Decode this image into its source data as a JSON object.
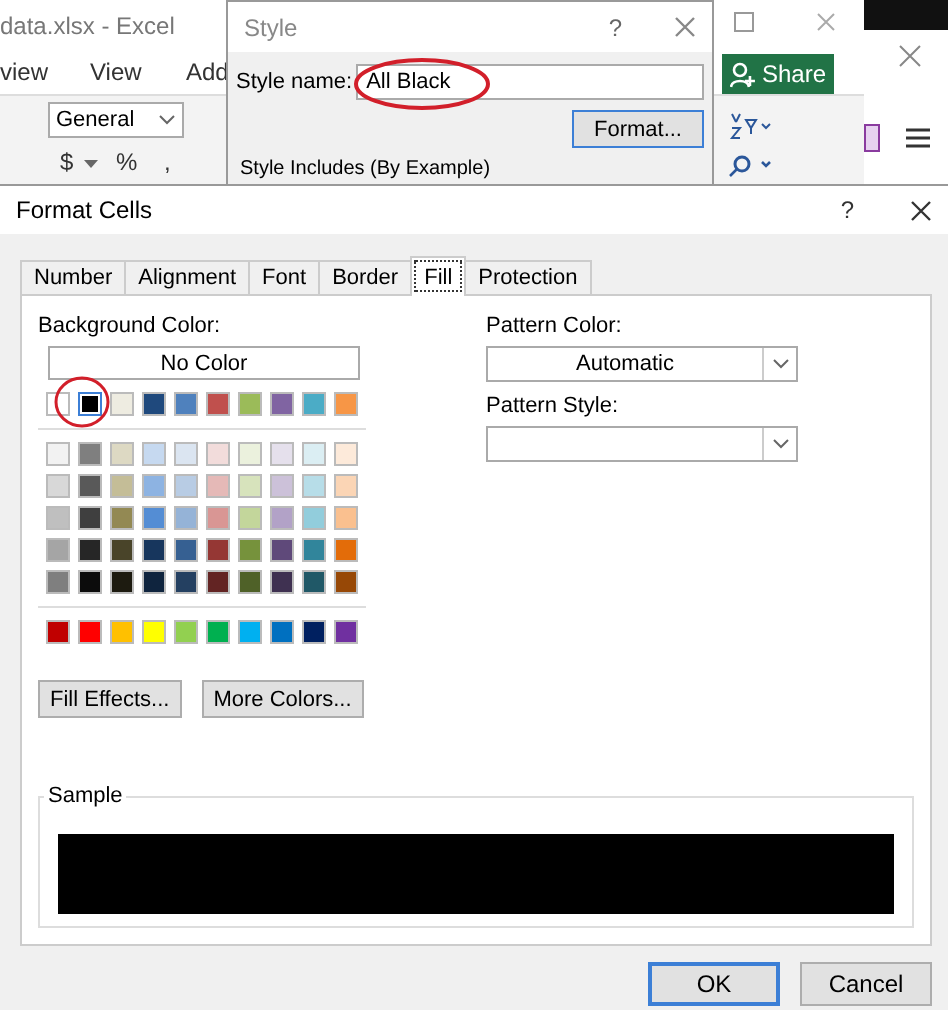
{
  "excel": {
    "title": "data.xlsx - Excel",
    "ribbon_tabs": [
      "view",
      "View",
      "Add"
    ],
    "number_format": "General",
    "number_buttons": [
      "$",
      "%",
      ","
    ],
    "share": "Share"
  },
  "style_dialog": {
    "title": "Style",
    "help": "?",
    "style_name_label": "Style name:",
    "style_name": "All Black",
    "format_button": "Format...",
    "includes_label": "Style Includes (By Example)"
  },
  "format_cells": {
    "title": "Format Cells",
    "help": "?",
    "tabs": [
      {
        "label": "Number",
        "selected": false
      },
      {
        "label": "Alignment",
        "selected": false
      },
      {
        "label": "Font",
        "selected": false
      },
      {
        "label": "Border",
        "selected": false
      },
      {
        "label": "Fill",
        "selected": true
      },
      {
        "label": "Protection",
        "selected": false
      }
    ],
    "background_color_label": "Background Color:",
    "no_color": "No Color",
    "theme_colors": [
      {
        "color": "#ffffff",
        "selected": false
      },
      {
        "color": "#000000",
        "selected": true
      },
      {
        "color": "#eeece1",
        "selected": false
      },
      {
        "color": "#1f497d",
        "selected": false
      },
      {
        "color": "#4f81bd",
        "selected": false
      },
      {
        "color": "#c0504d",
        "selected": false
      },
      {
        "color": "#9bbb59",
        "selected": false
      },
      {
        "color": "#8064a2",
        "selected": false
      },
      {
        "color": "#4bacc6",
        "selected": false
      },
      {
        "color": "#f79646",
        "selected": false
      }
    ],
    "tint_rows": [
      [
        {
          "color": "#f2f2f2",
          "selected": false
        },
        {
          "color": "#7f7f7f",
          "selected": false
        },
        {
          "color": "#ddd9c3",
          "selected": false
        },
        {
          "color": "#c6d9f0",
          "selected": false
        },
        {
          "color": "#dbe5f1",
          "selected": false
        },
        {
          "color": "#f2dcdb",
          "selected": false
        },
        {
          "color": "#ebf1dd",
          "selected": false
        },
        {
          "color": "#e5e0ec",
          "selected": false
        },
        {
          "color": "#dbeef3",
          "selected": false
        },
        {
          "color": "#fdeada",
          "selected": false
        }
      ],
      [
        {
          "color": "#d8d8d8",
          "selected": false
        },
        {
          "color": "#595959",
          "selected": false
        },
        {
          "color": "#c4bd97",
          "selected": false
        },
        {
          "color": "#8db3e2",
          "selected": false
        },
        {
          "color": "#b8cce4",
          "selected": false
        },
        {
          "color": "#e5b9b7",
          "selected": false
        },
        {
          "color": "#d7e3bc",
          "selected": false
        },
        {
          "color": "#ccc1d9",
          "selected": false
        },
        {
          "color": "#b7dde8",
          "selected": false
        },
        {
          "color": "#fbd5b5",
          "selected": false
        }
      ],
      [
        {
          "color": "#bfbfbf",
          "selected": false
        },
        {
          "color": "#3f3f3f",
          "selected": false
        },
        {
          "color": "#938953",
          "selected": false
        },
        {
          "color": "#548dd4",
          "selected": false
        },
        {
          "color": "#95b3d7",
          "selected": false
        },
        {
          "color": "#d99694",
          "selected": false
        },
        {
          "color": "#c3d69b",
          "selected": false
        },
        {
          "color": "#b2a2c7",
          "selected": false
        },
        {
          "color": "#92cddc",
          "selected": false
        },
        {
          "color": "#fac08f",
          "selected": false
        }
      ],
      [
        {
          "color": "#a5a5a5",
          "selected": false
        },
        {
          "color": "#262626",
          "selected": false
        },
        {
          "color": "#494429",
          "selected": false
        },
        {
          "color": "#17365d",
          "selected": false
        },
        {
          "color": "#366092",
          "selected": false
        },
        {
          "color": "#953734",
          "selected": false
        },
        {
          "color": "#76923c",
          "selected": false
        },
        {
          "color": "#5f497a",
          "selected": false
        },
        {
          "color": "#31859b",
          "selected": false
        },
        {
          "color": "#e36c09",
          "selected": false
        }
      ],
      [
        {
          "color": "#7f7f7f",
          "selected": false
        },
        {
          "color": "#0c0c0c",
          "selected": false
        },
        {
          "color": "#1d1b10",
          "selected": false
        },
        {
          "color": "#0f243e",
          "selected": false
        },
        {
          "color": "#244061",
          "selected": false
        },
        {
          "color": "#632423",
          "selected": false
        },
        {
          "color": "#4f6128",
          "selected": false
        },
        {
          "color": "#3f3151",
          "selected": false
        },
        {
          "color": "#205867",
          "selected": false
        },
        {
          "color": "#974806",
          "selected": false
        }
      ]
    ],
    "standard_colors": [
      {
        "color": "#c00000",
        "selected": false
      },
      {
        "color": "#ff0000",
        "selected": false
      },
      {
        "color": "#ffc000",
        "selected": false
      },
      {
        "color": "#ffff00",
        "selected": false
      },
      {
        "color": "#92d050",
        "selected": false
      },
      {
        "color": "#00b050",
        "selected": false
      },
      {
        "color": "#00b0f0",
        "selected": false
      },
      {
        "color": "#0070c0",
        "selected": false
      },
      {
        "color": "#002060",
        "selected": false
      },
      {
        "color": "#7030a0",
        "selected": false
      }
    ],
    "fill_effects": "Fill Effects...",
    "more_colors": "More Colors...",
    "pattern_color_label": "Pattern Color:",
    "pattern_color": "Automatic",
    "pattern_style_label": "Pattern Style:",
    "sample_label": "Sample",
    "buttons": [
      {
        "label": "OK",
        "default": true
      },
      {
        "label": "Cancel",
        "default": false
      }
    ]
  }
}
